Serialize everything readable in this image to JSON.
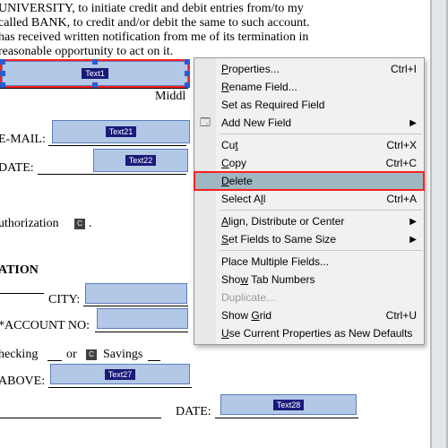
{
  "doc": {
    "line1": "UNIVERSITY, to initiate credit and debit entries from/to my",
    "line2": "called BANK, to credit and/or debit the same to such account.",
    "line3": "has received written notification from me of its termination in",
    "line4": "reasonable opportunity to act on it.",
    "middl": "Middl",
    "email_label": "E-MAIL:",
    "date_label": "DATE:",
    "auth_text": "uthorization",
    "ation_header": "ATION",
    "city_label": "CITY:",
    "acct_label": "*ACCOUNT NO:",
    "checking": "hecking",
    "or": "or",
    "savings": "Savings",
    "above": "ABOVE:",
    "date2_label": "DATE:"
  },
  "fields": {
    "text1": "Text1",
    "text21": "Text21",
    "text22": "Text22",
    "text27": "Text27",
    "text28": "Text28",
    "cb1": "C",
    "cb2": "C"
  },
  "menu": {
    "properties": "Properties...",
    "properties_key": "Ctrl+I",
    "rename": "Rename Field...",
    "set_required": "Set as Required Field",
    "add_new": "Add New Field",
    "cut": "Cut",
    "cut_key": "Ctrl+X",
    "copy": "Copy",
    "copy_key": "Ctrl+C",
    "delete": "Delete",
    "select_all": "Select All",
    "select_all_key": "Ctrl+A",
    "align": "Align, Distribute or Center",
    "same_size": "Set Fields to Same Size",
    "place_multiple": "Place Multiple Fields...",
    "show_tab": "Show Tab Numbers",
    "duplicate": "Duplicate...",
    "show_grid": "Show Grid",
    "show_grid_key": "Ctrl+U",
    "use_defaults": "Use Current Properties as New Defaults"
  }
}
